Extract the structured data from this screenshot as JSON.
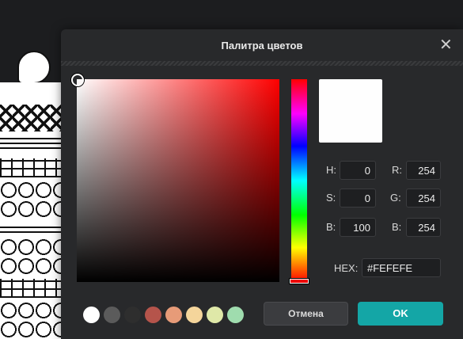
{
  "dialog": {
    "title": "Палитра цветов",
    "close_icon": "close-icon"
  },
  "picker": {
    "current_color": "#fefefe",
    "hue_base_color": "#ff0000"
  },
  "fields": {
    "h_label": "H:",
    "h_value": "0",
    "s_label": "S:",
    "s_value": "0",
    "b_label": "B:",
    "b_value": "100",
    "r_label": "R:",
    "r_value": "254",
    "g_label": "G:",
    "g_value": "254",
    "b2_label": "B:",
    "b2_value": "254",
    "hex_label": "HEX:",
    "hex_value": "#FEFEFE"
  },
  "swatches": [
    "#ffffff",
    "#5b5b5b",
    "#2e2e2e",
    "#b5544b",
    "#e79b78",
    "#f5d59b",
    "#dfe8a8",
    "#9fdcae"
  ],
  "buttons": {
    "cancel": "Отмена",
    "ok": "OK"
  }
}
